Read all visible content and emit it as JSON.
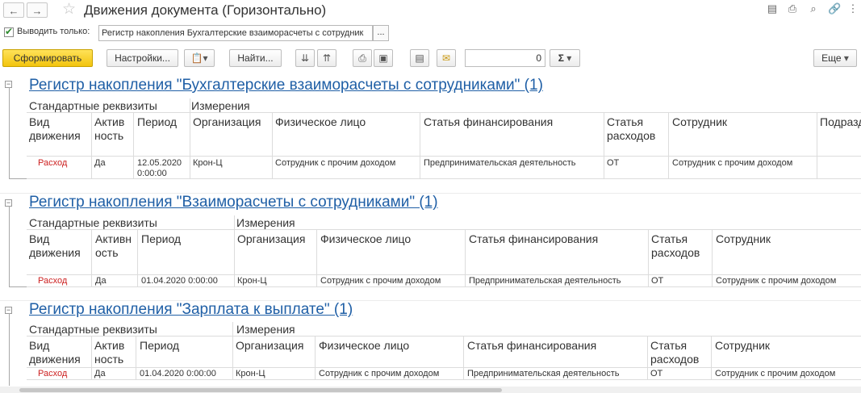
{
  "window": {
    "title": "Движения документа (Горизонтально)",
    "icons": [
      "back-icon",
      "forward-icon",
      "star-icon",
      "save-icon",
      "print-icon",
      "preview-icon",
      "link-icon",
      "more-icon"
    ]
  },
  "filter": {
    "checkbox_label": "Выводить только:",
    "checked": true,
    "value": "Регистр накопления Бухгалтерские взаиморасчеты с сотрудник",
    "select_label": "..."
  },
  "toolbar": {
    "generate_label": "Сформировать",
    "settings_label": "Настройки...",
    "find_label": "Найти...",
    "sum_value": "0",
    "sum_label": "Σ",
    "more_label": "Еще"
  },
  "registers": [
    {
      "title": "Регистр накопления \"Бухгалтерские взаиморасчеты с сотрудниками\" (1)",
      "section_std": "Стандартные реквизиты",
      "section_dims": "Измерения",
      "headers": [
        "Вид движения",
        "Актив ность",
        "Период",
        "Организация",
        "Физическое лицо",
        "Статья финансирования",
        "Статья расходов",
        "Сотрудник",
        "Подразд"
      ],
      "rows": [
        [
          "Расход",
          "Да",
          "12.05.2020 0:00:00",
          "Крон-Ц",
          "Сотрудник с прочим доходом",
          "Предпринимательская деятельность",
          "ОТ",
          "Сотрудник с прочим доходом",
          ""
        ]
      ]
    },
    {
      "title": "Регистр накопления \"Взаиморасчеты с сотрудниками\" (1)",
      "section_std": "Стандартные реквизиты",
      "section_dims": "Измерения",
      "headers": [
        "Вид движения",
        "Активн ость",
        "Период",
        "Организация",
        "Физическое лицо",
        "Статья финансирования",
        "Статья расходов",
        "Сотрудник"
      ],
      "rows": [
        [
          "Расход",
          "Да",
          "01.04.2020 0:00:00",
          "Крон-Ц",
          "Сотрудник с прочим доходом",
          "Предпринимательская деятельность",
          "ОТ",
          "Сотрудник с прочим доходом"
        ]
      ]
    },
    {
      "title": "Регистр накопления \"Зарплата к выплате\" (1)",
      "section_std": "Стандартные реквизиты",
      "section_dims": "Измерения",
      "headers": [
        "Вид движения",
        "Актив ность",
        "Период",
        "Организация",
        "Физическое лицо",
        "Статья финансирования",
        "Статья расходов",
        "Сотрудник"
      ],
      "rows": [
        [
          "Расход",
          "Да",
          "01.04.2020 0:00:00",
          "Крон-Ц",
          "Сотрудник с прочим доходом",
          "Предпринимательская деятельность",
          "ОТ",
          "Сотрудник с прочим доходом"
        ]
      ]
    }
  ]
}
